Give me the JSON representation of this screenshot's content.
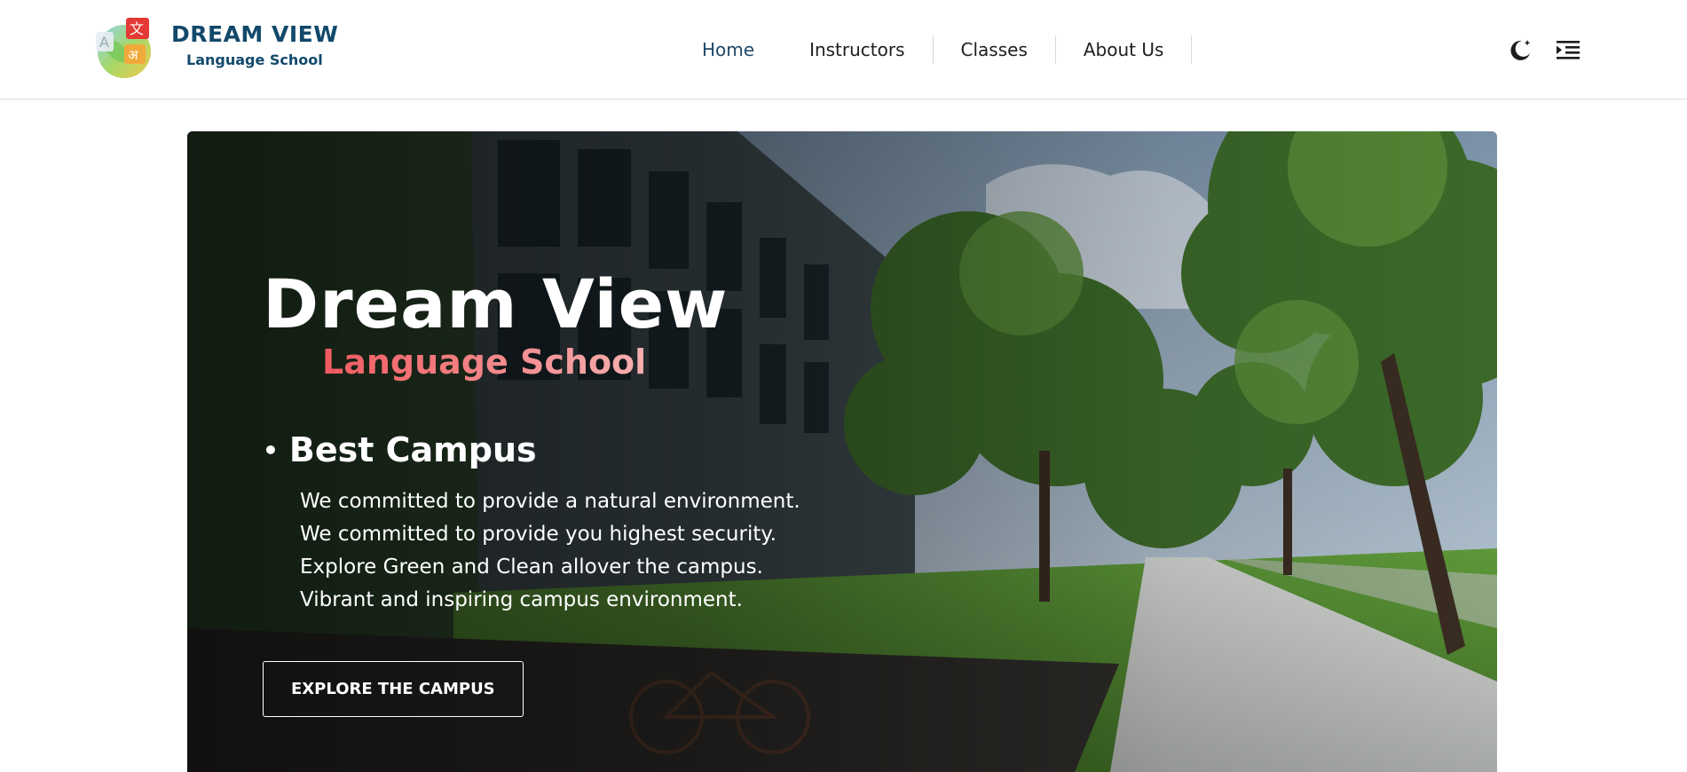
{
  "header": {
    "brand_title": "DREAM VIEW",
    "brand_subtitle": "Language School",
    "logo_glyphs": [
      "A",
      "文",
      "अ"
    ]
  },
  "nav": {
    "items": [
      {
        "label": "Home",
        "active": true
      },
      {
        "label": "Instructors",
        "active": false
      },
      {
        "label": "Classes",
        "active": false
      },
      {
        "label": "About Us",
        "active": false
      }
    ]
  },
  "actions": {
    "theme_icon": "moon-icon",
    "menu_icon": "menu-indent-icon"
  },
  "hero": {
    "title": "Dream View",
    "subtitle": "Language School",
    "feature_heading": "Best Campus",
    "features": [
      "We committed to provide a natural environment.",
      "We committed to provide you highest security.",
      "Explore Green and Clean allover the campus.",
      "Vibrant and inspiring campus environment."
    ],
    "cta_label": "EXPLORE THE CAMPUS"
  },
  "colors": {
    "brand": "#12496b",
    "nav_active": "#1f4868",
    "subtitle_gradient_start": "#f05a60",
    "subtitle_gradient_end": "#f5b0b0"
  }
}
